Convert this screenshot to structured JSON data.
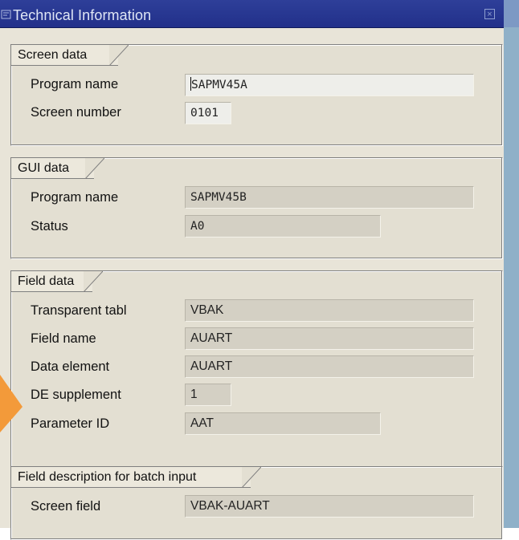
{
  "window": {
    "title": "Technical Information",
    "title_icon": "window-menu-icon",
    "close_icon": "close-icon"
  },
  "groups": {
    "screen": {
      "title": "Screen data",
      "program_name_label": "Program name",
      "program_name_value": "SAPMV45A",
      "screen_number_label": "Screen number",
      "screen_number_value": "0101"
    },
    "gui": {
      "title": "GUI data",
      "program_name_label": "Program name",
      "program_name_value": "SAPMV45B",
      "status_label": "Status",
      "status_value": "A0"
    },
    "field": {
      "title": "Field data",
      "transparent_table_label": "Transparent tabl",
      "transparent_table_value": "VBAK",
      "field_name_label": "Field name",
      "field_name_value": "AUART",
      "data_element_label": "Data element",
      "data_element_value": "AUART",
      "de_supplement_label": "DE supplement",
      "de_supplement_value": "1",
      "parameter_id_label": "Parameter ID",
      "parameter_id_value": "AAT"
    },
    "batch": {
      "title": "Field description for batch input",
      "screen_field_label": "Screen field",
      "screen_field_value": "VBAK-AUART"
    }
  },
  "colors": {
    "titlebar": "#22308a",
    "dialog_bg": "#e8e4d8",
    "arrow": "#f39a3a"
  }
}
